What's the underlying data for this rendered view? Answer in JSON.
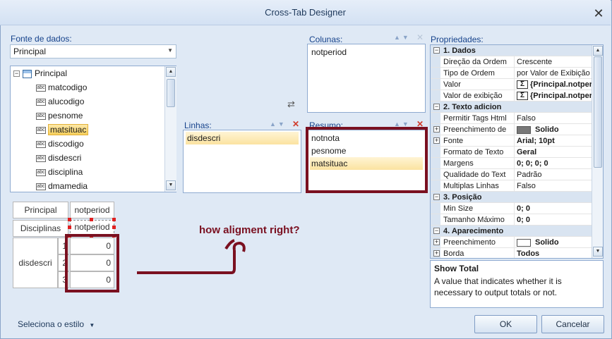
{
  "window": {
    "title": "Cross-Tab Designer"
  },
  "datasource": {
    "label": "Fonte de dados:",
    "selected": "Principal",
    "tree": {
      "root": "Principal",
      "fields": [
        "matcodigo",
        "alucodigo",
        "pesnome",
        "matsituac",
        "discodigo",
        "disdescri",
        "disciplina",
        "dmamedia"
      ],
      "selected_field": "matsituac"
    }
  },
  "columns": {
    "label": "Colunas:",
    "items": [
      "notperiod"
    ]
  },
  "rows": {
    "label": "Linhas:",
    "items": [
      "disdescri"
    ]
  },
  "summary": {
    "label": "Resumo:",
    "items": [
      "notnota",
      "pesnome",
      "matsituac"
    ],
    "selected": "matsituac"
  },
  "preview": {
    "corner_top": "Principal",
    "corner_bottom": "Disciplinas",
    "col_header": "notperiod",
    "col_header_sel": "notperiod",
    "row_header": "disdescri",
    "row_numbers": [
      "1",
      "2",
      "3"
    ],
    "cells": [
      "0",
      "0",
      "0"
    ]
  },
  "annotation": {
    "text": "how aligment right?",
    "color": "#7a1020"
  },
  "properties": {
    "label": "Propriedades:",
    "rows": [
      {
        "kind": "cat",
        "toggle": "⊟",
        "name": "1. Dados"
      },
      {
        "kind": "prop",
        "name": "Direção da Ordem",
        "value": "Crescente"
      },
      {
        "kind": "prop",
        "name": "Tipo de Ordem",
        "value": "por Valor de Exibição"
      },
      {
        "kind": "prop",
        "name": "Valor",
        "value": "{Principal.notper",
        "icon": "sigma",
        "bold": true
      },
      {
        "kind": "prop",
        "name": "Valor de exibição",
        "value": "{Principal.notper",
        "icon": "sigma",
        "bold": true
      },
      {
        "kind": "cat",
        "toggle": "⊟",
        "name": "2. Texto adicion"
      },
      {
        "kind": "prop",
        "name": "Permitir Tags Html",
        "value": "Falso"
      },
      {
        "kind": "prop",
        "name": "Preenchimento de",
        "value": "Solido",
        "expand": true,
        "swatch": "#777777",
        "bold": true
      },
      {
        "kind": "prop",
        "name": "Fonte",
        "value": "Arial; 10pt",
        "expand": true,
        "bold": true
      },
      {
        "kind": "prop",
        "name": "Formato de Texto",
        "value": "Geral",
        "bold": true
      },
      {
        "kind": "prop",
        "name": "Margens",
        "value": "0; 0; 0; 0",
        "bold": true
      },
      {
        "kind": "prop",
        "name": "Qualidade do Text",
        "value": "Padrão"
      },
      {
        "kind": "prop",
        "name": "Multiplas Linhas",
        "value": "Falso"
      },
      {
        "kind": "cat",
        "toggle": "⊟",
        "name": "3. Posição"
      },
      {
        "kind": "prop",
        "name": "Min Size",
        "value": "0; 0",
        "bold": true
      },
      {
        "kind": "prop",
        "name": "Tamanho Máximo",
        "value": "0; 0",
        "bold": true
      },
      {
        "kind": "cat",
        "toggle": "⊟",
        "name": "4. Aparecimento"
      },
      {
        "kind": "prop",
        "name": "Preenchimento",
        "value": "Solido",
        "expand": true,
        "swatch": "#ffffff",
        "bold": true
      },
      {
        "kind": "prop",
        "name": "Borda",
        "value": "Todos",
        "expand": true,
        "bold": true
      }
    ]
  },
  "help": {
    "title": "Show Total",
    "text": "A value that indicates whether it is necessary to output totals or not."
  },
  "footer": {
    "style_label": "Seleciona o estilo",
    "ok": "OK",
    "cancel": "Cancelar"
  }
}
